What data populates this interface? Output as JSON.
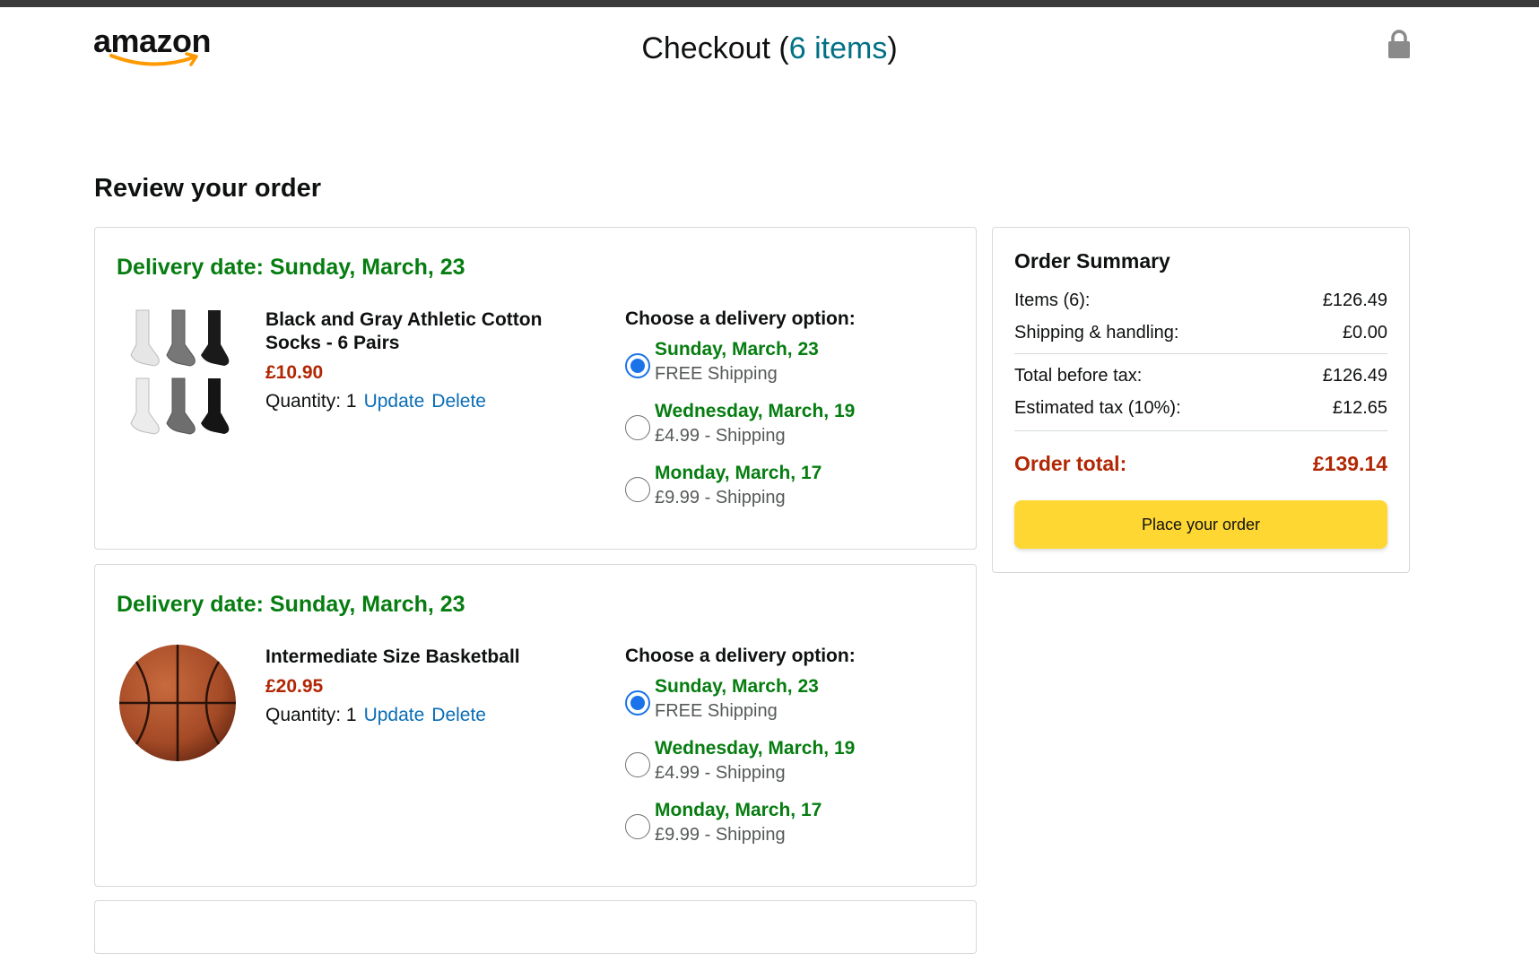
{
  "header": {
    "logo_text": "amazon",
    "title_prefix": "Checkout (",
    "title_count": "6 items",
    "title_suffix": ")"
  },
  "review_title": "Review your order",
  "shipments": [
    {
      "delivery_date": "Delivery date: Sunday, March, 23",
      "product": {
        "name": "Black and Gray Athletic Cotton Socks - 6 Pairs",
        "price": "£10.90",
        "quantity_label": "Quantity: 1",
        "update": "Update",
        "delete": "Delete"
      },
      "options_title": "Choose a delivery option:",
      "options": [
        {
          "date": "Sunday, March, 23",
          "cost": "FREE Shipping",
          "selected": true
        },
        {
          "date": "Wednesday, March, 19",
          "cost": "£4.99 - Shipping",
          "selected": false
        },
        {
          "date": "Monday, March, 17",
          "cost": "£9.99 - Shipping",
          "selected": false
        }
      ]
    },
    {
      "delivery_date": "Delivery date: Sunday, March, 23",
      "product": {
        "name": "Intermediate Size Basketball",
        "price": "£20.95",
        "quantity_label": "Quantity: 1",
        "update": "Update",
        "delete": "Delete"
      },
      "options_title": "Choose a delivery option:",
      "options": [
        {
          "date": "Sunday, March, 23",
          "cost": "FREE Shipping",
          "selected": true
        },
        {
          "date": "Wednesday, March, 19",
          "cost": "£4.99 - Shipping",
          "selected": false
        },
        {
          "date": "Monday, March, 17",
          "cost": "£9.99 - Shipping",
          "selected": false
        }
      ]
    }
  ],
  "summary": {
    "title": "Order Summary",
    "items_label": "Items (6):",
    "items_value": "£126.49",
    "shipping_label": "Shipping & handling:",
    "shipping_value": "£0.00",
    "before_tax_label": "Total before tax:",
    "before_tax_value": "£126.49",
    "tax_label": "Estimated tax (10%):",
    "tax_value": "£12.65",
    "total_label": "Order total:",
    "total_value": "£139.14",
    "place_order": "Place your order"
  },
  "colors": {
    "accent_teal": "#007185",
    "delivery_green": "#067d10",
    "price_red": "#b12704",
    "link_blue": "#0a6db5",
    "button_yellow": "#fed733",
    "radio_blue": "#1a73e8"
  },
  "icons": [
    "amazon-logo-smile",
    "lock-icon",
    "radio-selected",
    "radio-unselected"
  ]
}
